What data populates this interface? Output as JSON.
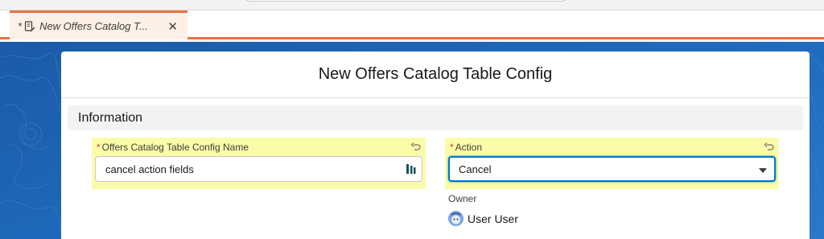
{
  "tab": {
    "modified_marker": "*",
    "title": "New Offers Catalog T...",
    "close_glyph": "✕",
    "icon": "record-edit-icon"
  },
  "modal": {
    "title": "New Offers Catalog Table Config"
  },
  "section": {
    "title": "Information"
  },
  "fields": {
    "name": {
      "required_marker": "*",
      "label": "Offers Catalog Table Config Name",
      "value": "cancel action fields"
    },
    "action": {
      "required_marker": "*",
      "label": "Action",
      "value": "Cancel"
    },
    "owner": {
      "label": "Owner",
      "value": "User User"
    }
  },
  "colors": {
    "accent_tab": "#e8733f",
    "highlight": "#fbfca8",
    "background": "#1b5ba7",
    "focus": "#0176d3"
  }
}
